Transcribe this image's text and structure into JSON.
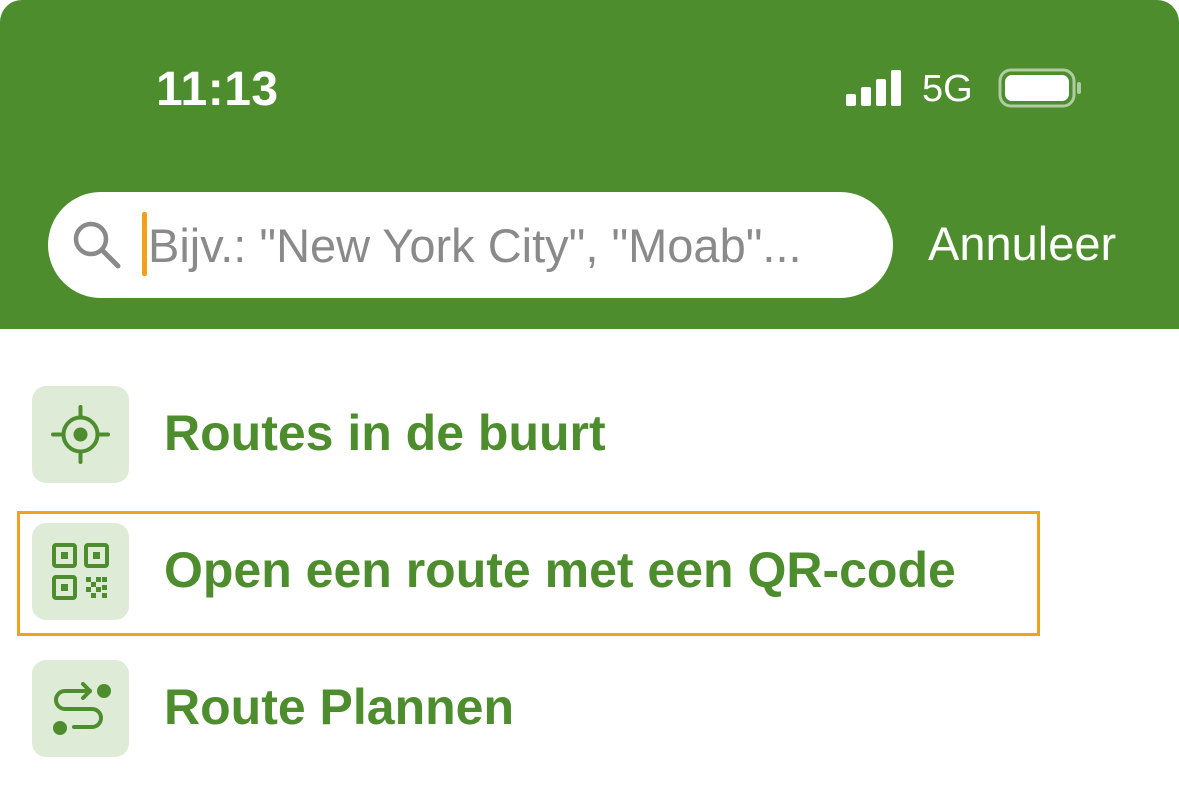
{
  "status_bar": {
    "time": "11:13",
    "network": "5G",
    "signal_icon": "signal-bars-icon",
    "battery_icon": "battery-icon"
  },
  "search": {
    "placeholder": "Bijv.: \"New York City\", \"Moab\"...",
    "value": "",
    "cancel_label": "Annuleer",
    "icon": "search-icon"
  },
  "menu": {
    "items": [
      {
        "label": "Routes in de buurt",
        "icon": "locate-crosshair-icon"
      },
      {
        "label": "Open een route met een QR-code",
        "icon": "qr-code-icon"
      },
      {
        "label": "Route Plannen",
        "icon": "route-path-icon"
      }
    ]
  },
  "colors": {
    "brand_green": "#4e8d2e",
    "icon_bg": "#deebd6",
    "highlight_orange": "#f2a11c"
  }
}
